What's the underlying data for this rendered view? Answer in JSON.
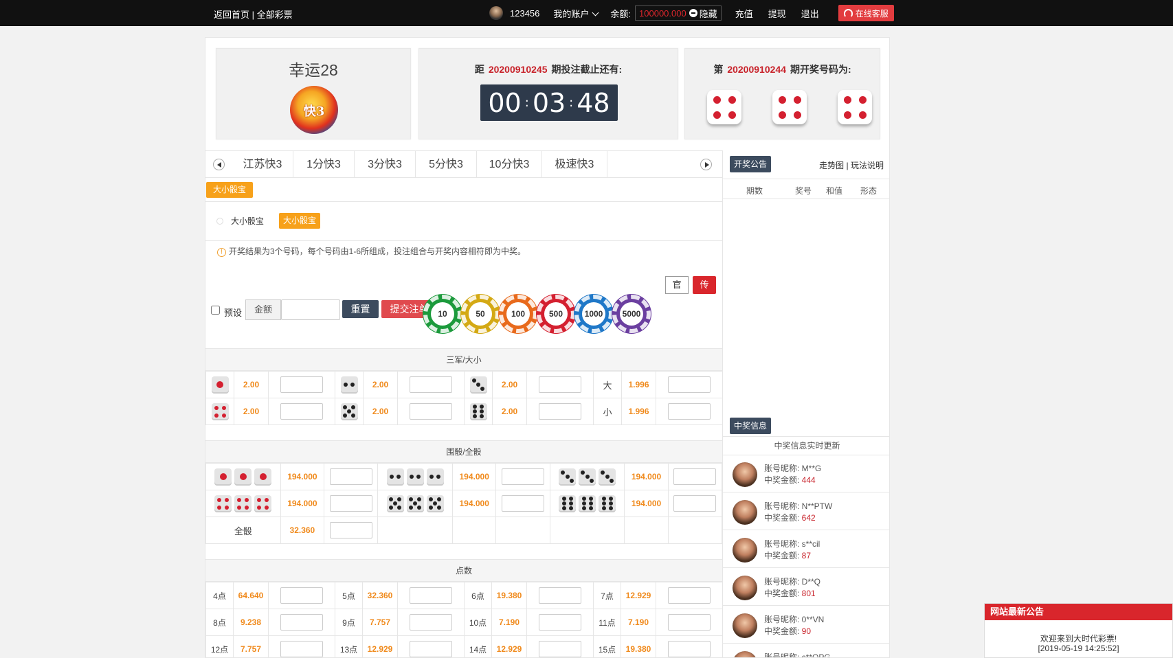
{
  "topbar": {
    "home": "返回首页",
    "sep": "|",
    "all_lottery": "全部彩票",
    "username": "123456",
    "my_account": "我的账户",
    "balance_label": "余额:",
    "balance": "100000.000",
    "hide": "隐藏",
    "recharge": "充值",
    "withdraw": "提现",
    "logout": "退出",
    "service": "在线客服"
  },
  "game": {
    "name": "幸运28",
    "logo_text": "快3"
  },
  "countdown": {
    "prefix": "距",
    "issue": "20200910245",
    "suffix": "期投注截止还有:",
    "hh": "00",
    "mm": "03",
    "ss": "48"
  },
  "result": {
    "prefix": "第",
    "issue": "20200910244",
    "suffix": "期开奖号码为:",
    "dice": [
      4,
      4,
      4
    ]
  },
  "tabs": [
    "江苏快3",
    "1分快3",
    "3分快3",
    "5分快3",
    "10分快3",
    "极速快3"
  ],
  "play": {
    "tag": "大小骰宝",
    "sub_label": "大小骰宝",
    "sub_tag": "大小骰宝",
    "note": "开奖结果为3个号码，每个号码由1-6所组成，投注组合与开奖内容相符即为中奖。",
    "btn_guan": "官",
    "btn_chuan": "传"
  },
  "bet": {
    "preset": "预设",
    "amount_label": "金额",
    "reset": "重置",
    "submit": "提交注单",
    "chips": [
      {
        "value": "10",
        "color": "#1c9a3c"
      },
      {
        "value": "50",
        "color": "#d4a914"
      },
      {
        "value": "100",
        "color": "#e86a1c"
      },
      {
        "value": "500",
        "color": "#d42030"
      },
      {
        "value": "1000",
        "color": "#1f78c8"
      },
      {
        "value": "5000",
        "color": "#6b3fa0"
      }
    ]
  },
  "sections": {
    "s1": "三军/大小",
    "s2": "围骰/全骰",
    "s3": "点数"
  },
  "s1_rows": [
    [
      {
        "die": 1,
        "odds": "2.00"
      },
      {
        "die": 2,
        "odds": "2.00"
      },
      {
        "die": 3,
        "odds": "2.00"
      },
      {
        "label": "大",
        "odds": "1.996"
      }
    ],
    [
      {
        "die": 4,
        "odds": "2.00"
      },
      {
        "die": 5,
        "odds": "2.00"
      },
      {
        "die": 6,
        "odds": "2.00"
      },
      {
        "label": "小",
        "odds": "1.996"
      }
    ]
  ],
  "s2_rows": [
    [
      {
        "die": 1,
        "odds": "194.000"
      },
      {
        "die": 2,
        "odds": "194.000"
      },
      {
        "die": 3,
        "odds": "194.000"
      }
    ],
    [
      {
        "die": 4,
        "odds": "194.000"
      },
      {
        "die": 5,
        "odds": "194.000"
      },
      {
        "die": 6,
        "odds": "194.000"
      }
    ]
  ],
  "all_dice": {
    "label": "全骰",
    "odds": "32.360"
  },
  "s3_rows": [
    [
      {
        "label": "4点",
        "odds": "64.640"
      },
      {
        "label": "5点",
        "odds": "32.360"
      },
      {
        "label": "6点",
        "odds": "19.380"
      },
      {
        "label": "7点",
        "odds": "12.929"
      }
    ],
    [
      {
        "label": "8点",
        "odds": "9.238"
      },
      {
        "label": "9点",
        "odds": "7.757"
      },
      {
        "label": "10点",
        "odds": "7.190"
      },
      {
        "label": "11点",
        "odds": "7.190"
      }
    ],
    [
      {
        "label": "12点",
        "odds": "7.757"
      },
      {
        "label": "13点",
        "odds": "12.929"
      },
      {
        "label": "14点",
        "odds": "12.929"
      },
      {
        "label": "15点",
        "odds": "19.380"
      }
    ]
  ],
  "sidebar": {
    "announce": "开奖公告",
    "trend": "走势图",
    "sep": "|",
    "rules": "玩法说明",
    "cols": [
      "期数",
      "奖号",
      "和值",
      "形态"
    ],
    "win_info": "中奖信息",
    "realtime": "中奖信息实时更新",
    "nick_label": "账号昵称:",
    "amount_label": "中奖金额:",
    "winners": [
      {
        "nick": "M**G",
        "amount": "444"
      },
      {
        "nick": "N**PTW",
        "amount": "642"
      },
      {
        "nick": "s**cil",
        "amount": "87"
      },
      {
        "nick": "D**Q",
        "amount": "801"
      },
      {
        "nick": "0**VN",
        "amount": "90"
      },
      {
        "nick": "c**OPG",
        "amount": ""
      }
    ]
  },
  "notice": {
    "title": "网站最新公告",
    "line1": "欢迎来到大时代彩票!",
    "line2": "[2019-05-19 14:25:52]"
  }
}
